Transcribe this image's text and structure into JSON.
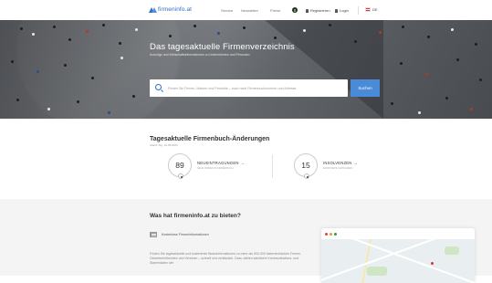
{
  "header": {
    "logo_text": "firmeninfo.at",
    "nav": [
      "Service",
      "Newsletter",
      "Preise"
    ],
    "register_label": "Registrieren",
    "login_label": "Login",
    "language": "DE"
  },
  "hero": {
    "title": "Das tagesaktuelle Firmenverzeichnis",
    "subtitle": "Auszüge und Wirtschaftsinformationen zu Unternehmen und Personen",
    "search_placeholder": "Finden Sie Firmen, Marken und Produkte – auch nach Firmenbuchnummer und Adresse",
    "search_button": "Suchen"
  },
  "changes": {
    "title": "Tagesaktuelle Firmenbuch-Änderungen",
    "date": "Stand: Stg. 29.03.2024",
    "stats": [
      {
        "count": "89",
        "label": "NEUEINTRAGUNGEN",
        "arrow": "→",
        "description": "NEUE FIRMEN IM FIRMENBUCH"
      },
      {
        "count": "15",
        "label": "INSOLVENZEN",
        "arrow": "→",
        "description": "ERÖFFNETE VERFAHREN"
      }
    ]
  },
  "features": {
    "title": "Was hat firmeninfo.at zu bieten?",
    "item_name": "Kostenlose Firmeninformationen",
    "item_desc": "Finden Sie tagesaktuelle und kostenfreie Basisinformationen zu mehr als 500.000 österreichischen Firmen, Gewerbetreibenden und Vereinen – schnell und verlässlich. Dazu zählen sämtliche Kommunikations- und Stammdaten wie"
  },
  "colors": {
    "brand_blue": "#2f6fc7",
    "search_button": "#4a8bd8"
  }
}
